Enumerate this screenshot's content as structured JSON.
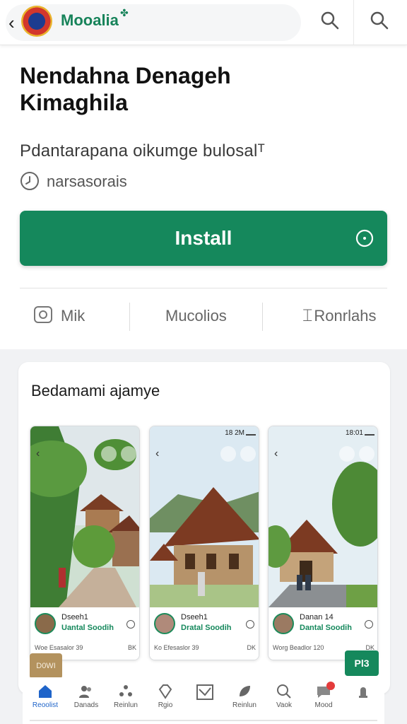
{
  "topbar": {
    "app_name": "Mooalia",
    "leaf_glyph": "✤",
    "icons": [
      "back-icon",
      "search-icon",
      "search-icon"
    ]
  },
  "header": {
    "title": "Nendahna Denageh\nKimaghila",
    "subtitle": "Pdantarapana oikumge bulosalᵀ",
    "meta": "narsasorais"
  },
  "install": {
    "label": "Install"
  },
  "stats": [
    {
      "label": "Mik",
      "icon": "camera-icon"
    },
    {
      "label": "Mucolios",
      "icon": ""
    },
    {
      "label": "Ronrlahs",
      "icon": "cursor-icon"
    }
  ],
  "gallery": {
    "title": "Bedamami ajamye",
    "screens": [
      {
        "time": "",
        "name": "Dseeh1",
        "sub": "Uantal Soodih",
        "foot_left": "Woe Esasalor 39",
        "foot_right": "BK"
      },
      {
        "time": "18 2M",
        "name": "Dseeh1",
        "sub": "Dratal Soodih",
        "foot_left": "Ko Efesaslor 39",
        "foot_right": "DK"
      },
      {
        "time": "18:01",
        "name": "Danan 14",
        "sub": "Dantal Soodih",
        "foot_left": "Worg Beadlor 120",
        "foot_right": "DK"
      }
    ],
    "chip_left": "D0WI",
    "chip_right": "Pl3"
  },
  "bottom_nav": [
    {
      "label": "Reoolist",
      "icon": "home-icon",
      "active": true
    },
    {
      "label": "Danads",
      "icon": "people-icon"
    },
    {
      "label": "Reinlun",
      "icon": "apps-icon"
    },
    {
      "label": "Rgio",
      "icon": "diamond-icon"
    },
    {
      "label": "",
      "icon": "mail-icon"
    },
    {
      "label": "Reinlun",
      "icon": "leaf-icon"
    },
    {
      "label": "Vaok",
      "icon": "search-icon"
    },
    {
      "label": "Mood",
      "icon": "chat-icon"
    },
    {
      "label": "",
      "icon": "profile-icon"
    }
  ],
  "colors": {
    "accent": "#15885c",
    "brand_green": "#17835a",
    "active_nav": "#1f64c9",
    "badge": "#e43b3b"
  }
}
